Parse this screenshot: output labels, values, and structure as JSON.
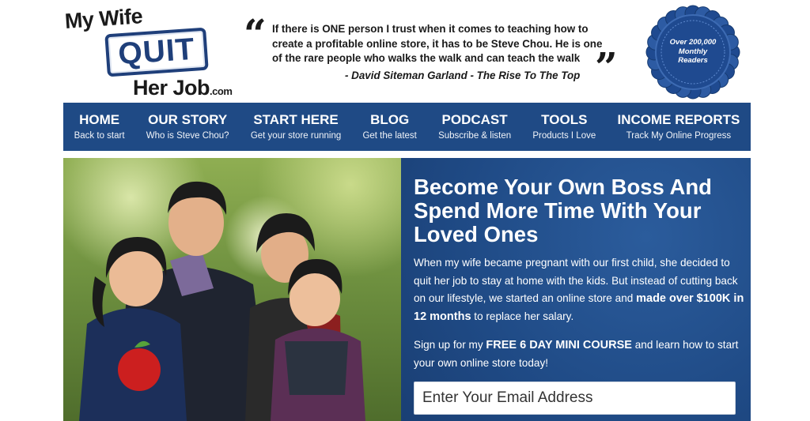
{
  "logo": {
    "line1": "My Wife",
    "line2": "QUIT",
    "line3": "Her Job",
    "suffix": ".com"
  },
  "quote": {
    "open_mark": "“",
    "close_mark": "”",
    "text": "If there is ONE person I trust when it comes to teaching how to create a profitable online store, it has to be Steve Chou. He is one of the rare people who walks the walk and can teach the walk",
    "attribution": "- David Siteman Garland - The Rise To The Top"
  },
  "badge": {
    "line1": "Over 200,000",
    "line2": "Monthly",
    "line3": "Readers"
  },
  "nav": {
    "items": [
      {
        "title": "HOME",
        "sub": "Back to start"
      },
      {
        "title": "OUR STORY",
        "sub": "Who is Steve Chou?"
      },
      {
        "title": "START HERE",
        "sub": "Get your store running"
      },
      {
        "title": "BLOG",
        "sub": "Get the latest"
      },
      {
        "title": "PODCAST",
        "sub": "Subscribe & listen"
      },
      {
        "title": "TOOLS",
        "sub": "Products I Love"
      },
      {
        "title": "INCOME REPORTS",
        "sub": "Track My Online Progress"
      }
    ]
  },
  "hero": {
    "headline": "Become Your Own Boss And Spend More Time With Your Loved Ones",
    "p1_start": "When my wife became pregnant with our first child, she decided to quit her job to stay at home with the kids. But instead of cutting back on our lifestyle, we started an online store and ",
    "p1_bold": "made over $100K in 12 months",
    "p1_end": " to replace her salary.",
    "p2_start": "Sign up for my ",
    "p2_bold": "FREE 6 DAY MINI COURSE",
    "p2_end": " and learn how to start your own online store today!",
    "email_placeholder": "Enter Your Email Address"
  },
  "colors": {
    "brand_blue": "#1f4a85",
    "badge_blue": "#1f4a90"
  }
}
